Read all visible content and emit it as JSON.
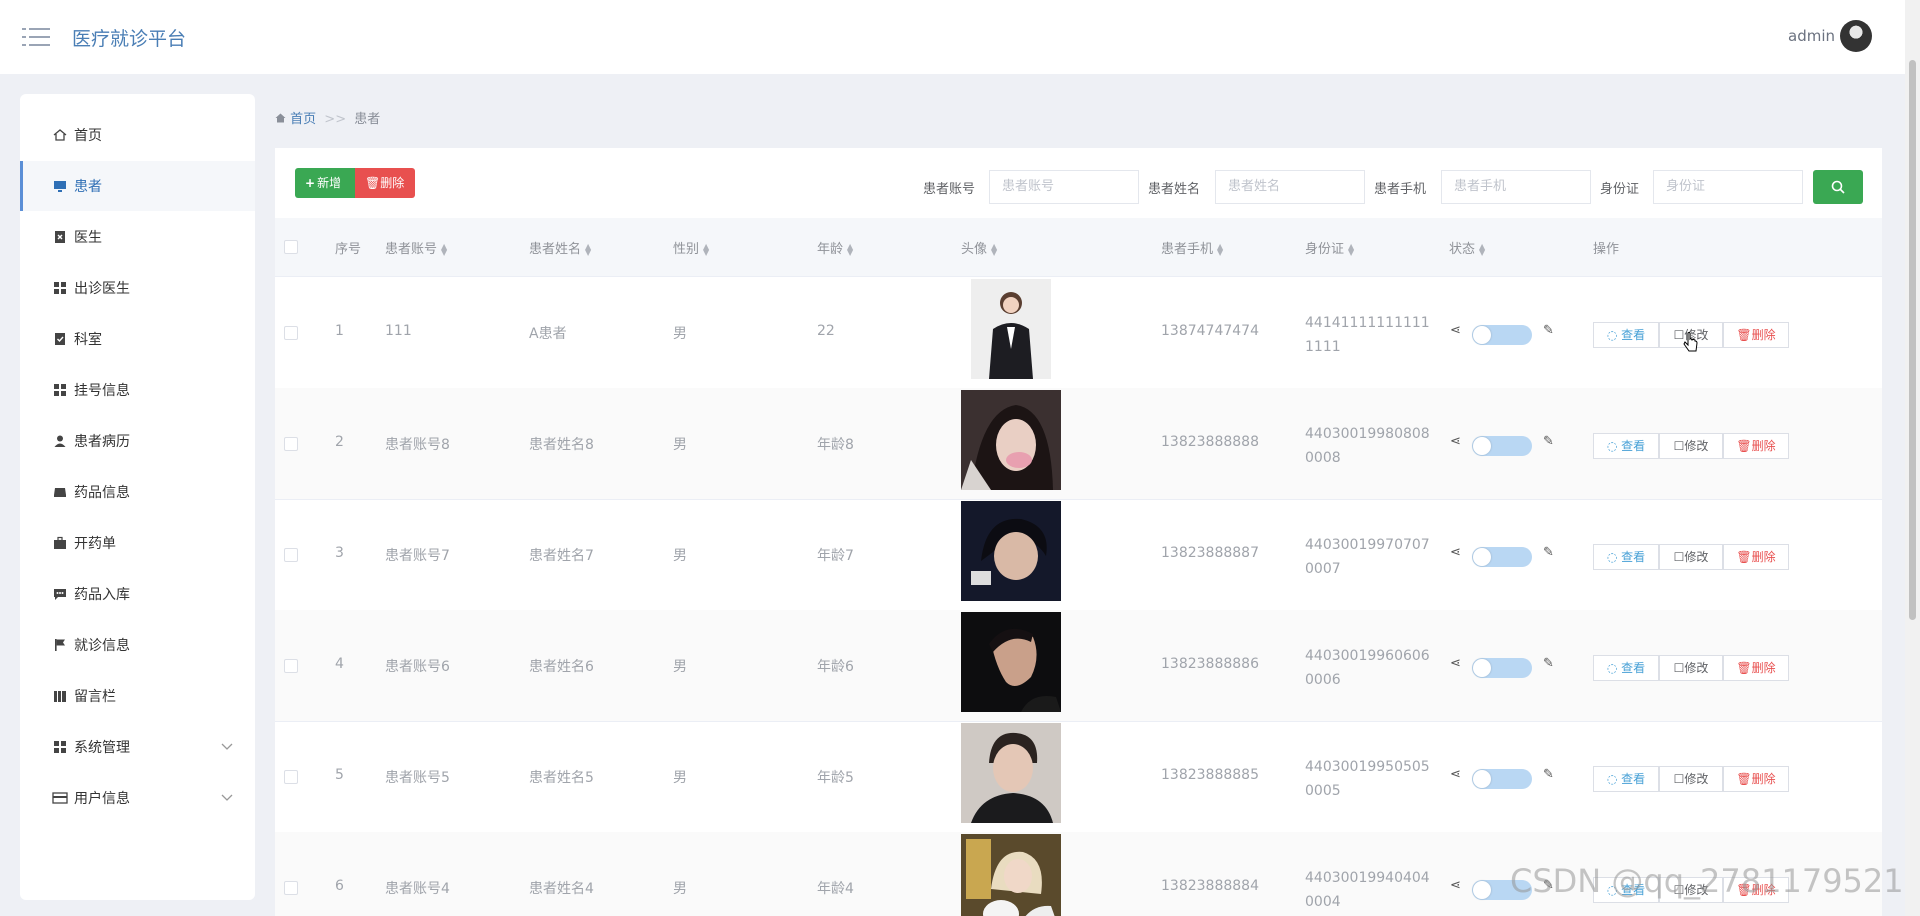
{
  "header": {
    "title": "医疗就诊平台",
    "user": "admin"
  },
  "sidebar": {
    "items": [
      {
        "label": "首页",
        "icon": "home-icon"
      },
      {
        "label": "患者",
        "icon": "monitor-icon"
      },
      {
        "label": "医生",
        "icon": "clipboard-x-icon"
      },
      {
        "label": "出诊医生",
        "icon": "grid-icon"
      },
      {
        "label": "科室",
        "icon": "clipboard-check-icon"
      },
      {
        "label": "挂号信息",
        "icon": "grid-icon"
      },
      {
        "label": "患者病历",
        "icon": "person-icon"
      },
      {
        "label": "药品信息",
        "icon": "tray-icon"
      },
      {
        "label": "开药单",
        "icon": "briefcase-icon"
      },
      {
        "label": "药品入库",
        "icon": "chat-icon"
      },
      {
        "label": "就诊信息",
        "icon": "flag-icon"
      },
      {
        "label": "留言栏",
        "icon": "book-icon"
      },
      {
        "label": "系统管理",
        "icon": "grid-icon"
      },
      {
        "label": "用户信息",
        "icon": "card-icon"
      }
    ]
  },
  "breadcrumb": {
    "home": "首页",
    "sep": ">>",
    "current": "患者"
  },
  "toolbar": {
    "add": "新增",
    "delete": "删除"
  },
  "filters": [
    {
      "label": "患者账号",
      "placeholder": "患者账号"
    },
    {
      "label": "患者姓名",
      "placeholder": "患者姓名"
    },
    {
      "label": "患者手机",
      "placeholder": "患者手机"
    },
    {
      "label": "身份证",
      "placeholder": "身份证"
    }
  ],
  "table": {
    "headers": [
      "序号",
      "患者账号",
      "患者姓名",
      "性别",
      "年龄",
      "头像",
      "患者手机",
      "身份证",
      "状态",
      "操作"
    ],
    "actions": {
      "view": "查看",
      "edit": "修改",
      "delete": "删除"
    },
    "rows": [
      {
        "no": "1",
        "account": "111",
        "name": "A患者",
        "gender": "男",
        "age": "22",
        "phone": "13874747474",
        "idcard": "441411111111111111"
      },
      {
        "no": "2",
        "account": "患者账号8",
        "name": "患者姓名8",
        "gender": "男",
        "age": "年龄8",
        "phone": "13823888888",
        "idcard": "440300199808080008"
      },
      {
        "no": "3",
        "account": "患者账号7",
        "name": "患者姓名7",
        "gender": "男",
        "age": "年龄7",
        "phone": "13823888887",
        "idcard": "440300199707070007"
      },
      {
        "no": "4",
        "account": "患者账号6",
        "name": "患者姓名6",
        "gender": "男",
        "age": "年龄6",
        "phone": "13823888886",
        "idcard": "440300199606060006"
      },
      {
        "no": "5",
        "account": "患者账号5",
        "name": "患者姓名5",
        "gender": "男",
        "age": "年龄5",
        "phone": "13823888885",
        "idcard": "440300199505050005"
      },
      {
        "no": "6",
        "account": "患者账号4",
        "name": "患者姓名4",
        "gender": "男",
        "age": "年龄4",
        "phone": "13823888884",
        "idcard": "440300199404040004"
      }
    ]
  },
  "watermark": "CSDN @qq_2781179521",
  "colors": {
    "primary": "#4a7eb5",
    "success": "#3aa853",
    "danger": "#e8504f"
  }
}
